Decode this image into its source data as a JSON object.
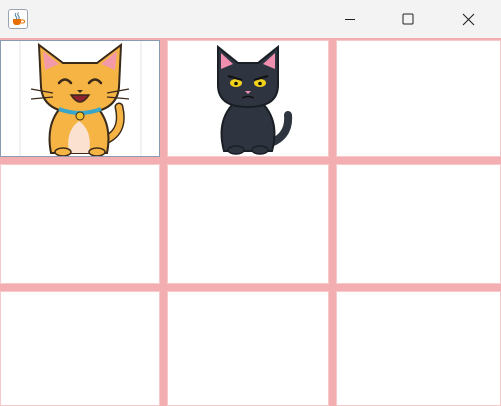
{
  "window": {
    "title": "",
    "controls": [
      {
        "name": "minimize",
        "icon": "minimize-icon"
      },
      {
        "name": "maximize",
        "icon": "maximize-icon"
      },
      {
        "name": "close",
        "icon": "close-icon"
      }
    ]
  },
  "app_icon": "java-coffee-cup-icon",
  "board": {
    "rows": 3,
    "cols": 3,
    "grid_color": "#f2aeb0",
    "cells": [
      {
        "row": 1,
        "col": 1,
        "content": "orange-cat",
        "focused": true
      },
      {
        "row": 1,
        "col": 2,
        "content": "black-cat",
        "focused": false
      },
      {
        "row": 1,
        "col": 3,
        "content": "",
        "focused": false
      },
      {
        "row": 2,
        "col": 1,
        "content": "",
        "focused": false
      },
      {
        "row": 2,
        "col": 2,
        "content": "",
        "focused": false
      },
      {
        "row": 2,
        "col": 3,
        "content": "",
        "focused": false
      },
      {
        "row": 3,
        "col": 1,
        "content": "",
        "focused": false
      },
      {
        "row": 3,
        "col": 2,
        "content": "",
        "focused": false
      },
      {
        "row": 3,
        "col": 3,
        "content": "",
        "focused": false
      }
    ]
  },
  "colors": {
    "orange_cat": "#f5b443",
    "black_cat": "#2f3540",
    "cat_eyes": "#f2d21b",
    "collar": "#3aa6c8"
  }
}
